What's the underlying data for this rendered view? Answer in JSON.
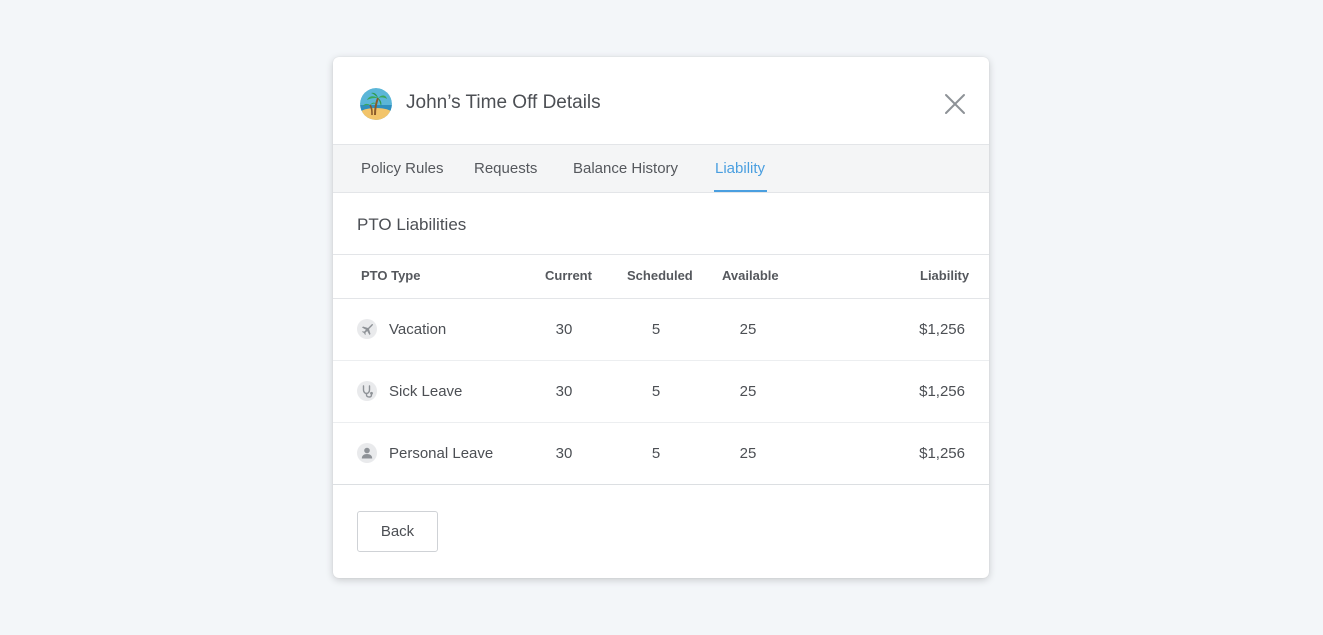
{
  "dialog": {
    "title": "John’s Time Off Details",
    "avatar_icon": "beach-palm-icon",
    "close_icon": "close-icon"
  },
  "tabs": [
    {
      "label": "Policy Rules",
      "active": false
    },
    {
      "label": "Requests",
      "active": false
    },
    {
      "label": "Balance History",
      "active": false
    },
    {
      "label": "Liability",
      "active": true
    }
  ],
  "section": {
    "title": "PTO Liabilities"
  },
  "table": {
    "columns": [
      "PTO Type",
      "Current",
      "Scheduled",
      "Available",
      "Liability"
    ],
    "rows": [
      {
        "icon": "airplane-icon",
        "type": "Vacation",
        "current": "30",
        "scheduled": "5",
        "available": "25",
        "liability": "$1,256"
      },
      {
        "icon": "stethoscope-icon",
        "type": "Sick Leave",
        "current": "30",
        "scheduled": "5",
        "available": "25",
        "liability": "$1,256"
      },
      {
        "icon": "person-icon",
        "type": "Personal Leave",
        "current": "30",
        "scheduled": "5",
        "available": "25",
        "liability": "$1,256"
      }
    ]
  },
  "footer": {
    "back_label": "Back"
  },
  "colors": {
    "accent": "#4a9fe0",
    "background": "#f3f6f9",
    "tab_bar": "#f4f5f6",
    "border": "#e3e5e8"
  }
}
